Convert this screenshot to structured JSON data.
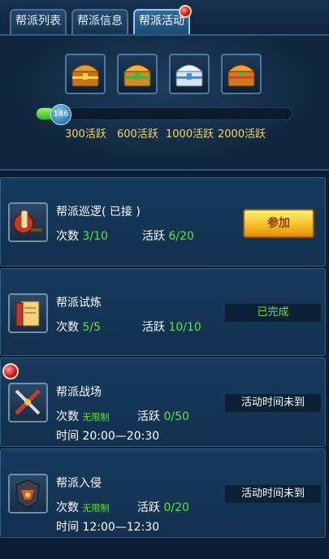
{
  "tabs": [
    {
      "label": "帮派列表"
    },
    {
      "label": "帮派信息"
    },
    {
      "label": "帮派活动"
    }
  ],
  "progress": {
    "value": "146",
    "fraction_filled": 0.07,
    "tiers": [
      "300活跃",
      "600活跃",
      "1000活跃",
      "2000活跃"
    ]
  },
  "activities": [
    {
      "title": "帮派巡逻( 已接 )",
      "count_label": "次数",
      "count_value": "3/10",
      "active_label": "活跃",
      "active_value": "6/20",
      "action": "参加"
    },
    {
      "title": "帮派试炼",
      "count_label": "次数",
      "count_value": "5/5",
      "active_label": "活跃",
      "active_value": "10/10",
      "status": "已完成"
    },
    {
      "title": "帮派战场",
      "count_label": "次数",
      "count_value": "无限制",
      "active_label": "活跃",
      "active_value": "0/50",
      "time_label": "时间",
      "time_value": "20:00—20:30",
      "status": "活动时间未到"
    },
    {
      "title": "帮派入侵",
      "count_label": "次数",
      "count_value": "无限制",
      "active_label": "活跃",
      "active_value": "0/20",
      "time_label": "时间",
      "time_value": "12:00—12:30",
      "status": "活动时间未到"
    }
  ],
  "colors": {
    "accent_green": "#5fe33d",
    "tier_yellow": "#f6d65b",
    "notify_red": "#d40f1f"
  },
  "icons": [
    "treasure-chest-icon",
    "patrol-banner-icon",
    "scroll-icon",
    "crossed-swords-icon",
    "invasion-icon"
  ]
}
